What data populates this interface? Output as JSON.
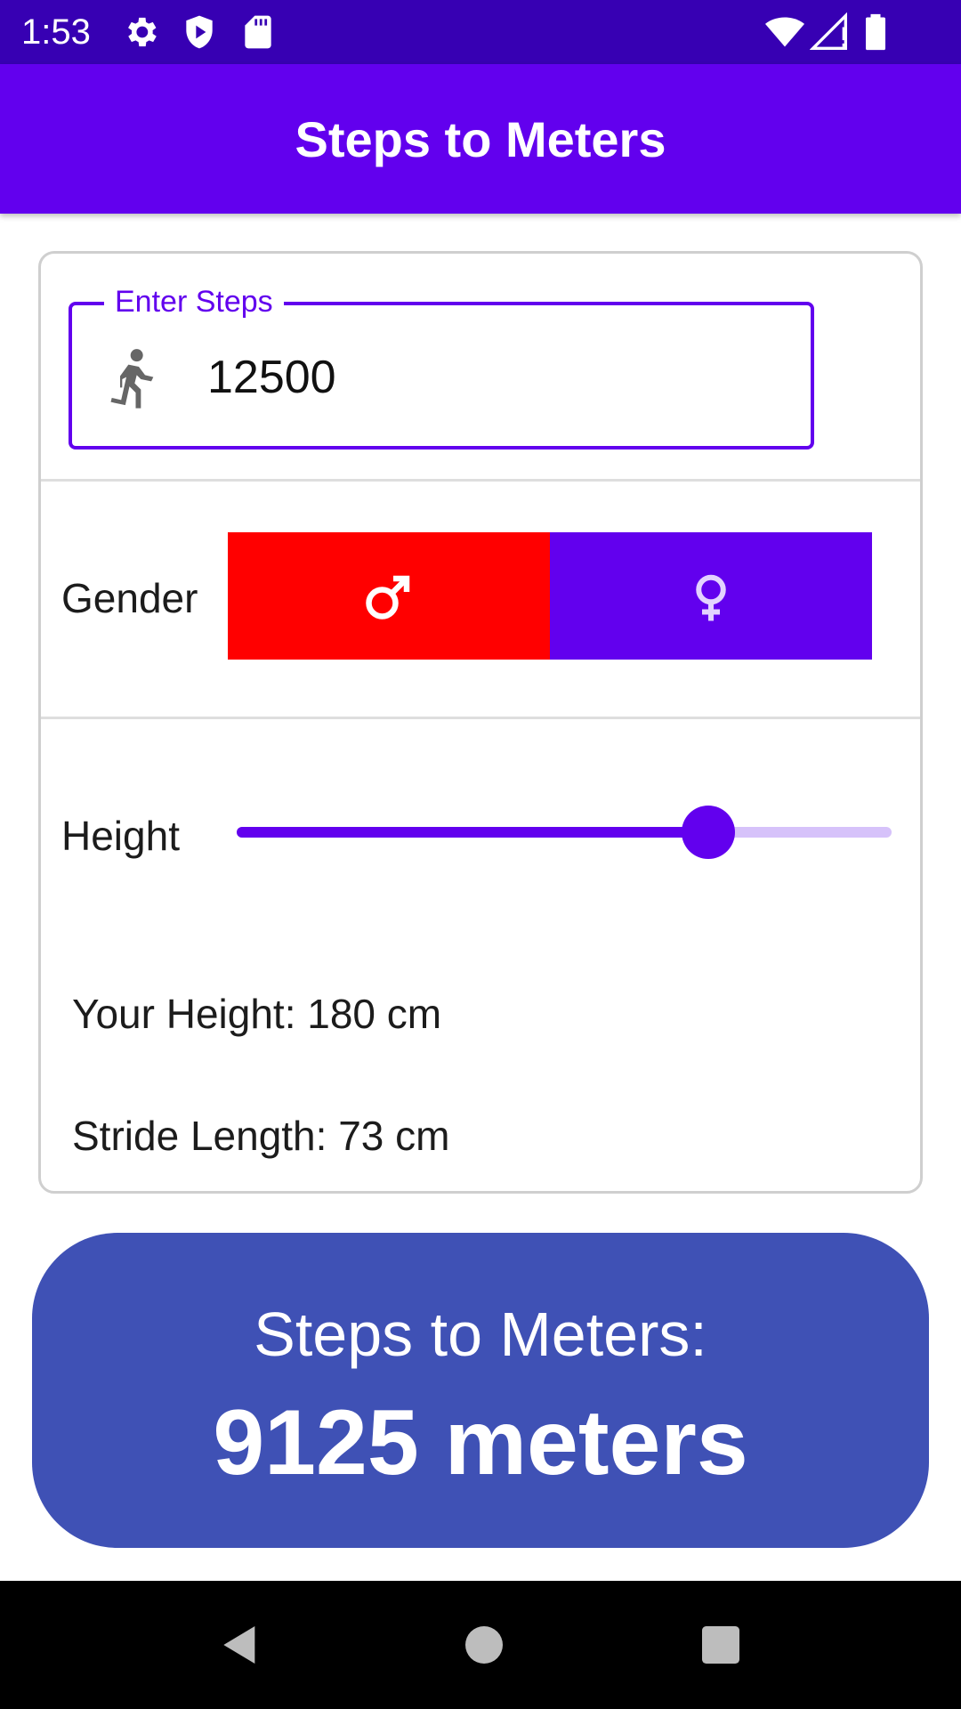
{
  "status_bar": {
    "time": "1:53",
    "icons": [
      "gear-icon",
      "shield-play-icon",
      "sd-card-icon",
      "wifi-icon",
      "signal-icon",
      "battery-icon"
    ],
    "background": "#3700B3"
  },
  "app_bar": {
    "title": "Steps to Meters",
    "background": "#6200EE"
  },
  "steps_input": {
    "label": "Enter Steps",
    "value": "12500",
    "icon": "run-icon"
  },
  "gender": {
    "label": "Gender",
    "options": [
      {
        "symbol": "♂",
        "icon": "male-icon",
        "color": "#FF0000",
        "selected": true
      },
      {
        "symbol": "♀",
        "icon": "female-icon",
        "color": "#6200EE",
        "selected": false
      }
    ]
  },
  "height": {
    "label": "Height",
    "slider_fraction": 0.72,
    "your_height": "Your Height: 180 cm",
    "stride_length": "Stride Length: 73 cm"
  },
  "result": {
    "label": "Steps to Meters:",
    "value": "9125 meters",
    "background": "#3F51B5"
  },
  "nav_bar": {
    "buttons": [
      "back-icon",
      "home-icon",
      "recents-icon"
    ]
  },
  "colors": {
    "accent": "#6200EE",
    "status_bar": "#3700B3",
    "male": "#FF0000",
    "result": "#3F51B5"
  }
}
